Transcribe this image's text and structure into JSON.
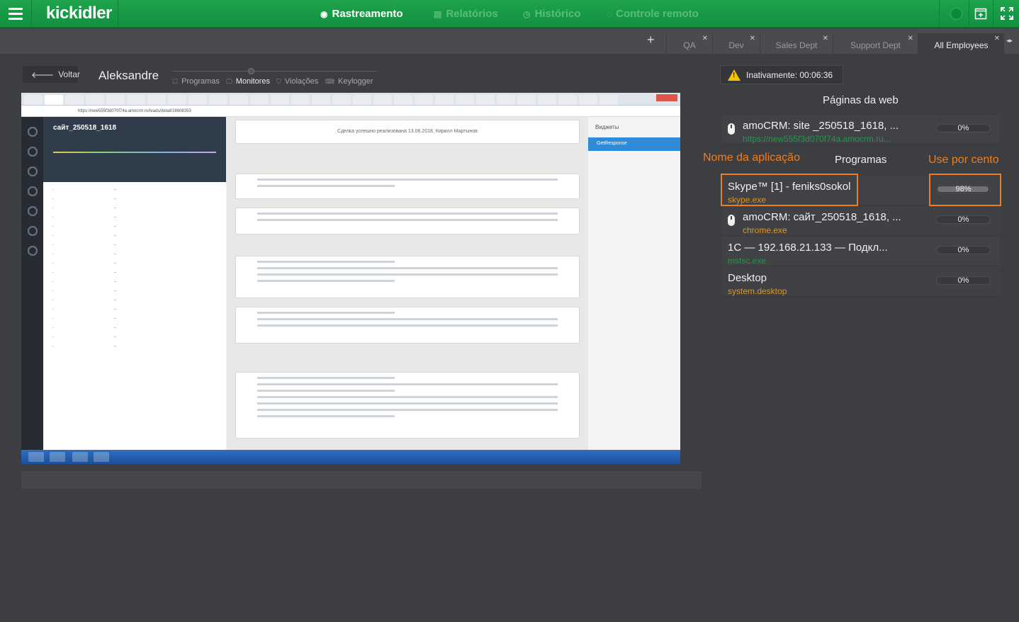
{
  "app": {
    "logo": "kickidler"
  },
  "nav": [
    {
      "label": "Rastreamento",
      "icon": "eye-icon",
      "glyph": "◉"
    },
    {
      "label": "Relatórios",
      "icon": "report-icon",
      "glyph": "▤"
    },
    {
      "label": "Histórico",
      "icon": "history-icon",
      "glyph": "◷"
    },
    {
      "label": "Controle remoto",
      "icon": "remote-icon",
      "glyph": "◌"
    }
  ],
  "tabs": [
    {
      "label": "QA"
    },
    {
      "label": "Dev"
    },
    {
      "label": "Sales Dept"
    },
    {
      "label": "Support Dept"
    },
    {
      "label": "All Employees"
    }
  ],
  "toolbar": {
    "back_label": "Voltar",
    "user_name": "Aleksandre",
    "submenu": [
      "Programas",
      "Monitores",
      "Violações",
      "Keylogger"
    ]
  },
  "screenshot": {
    "lead_title": "сайт_250518_1618",
    "url": "https://new555f3d070f74a.amocrm.ru/leads/detail/16608353",
    "status_banner": "Сделка успешно реализована 13.06.2018, Кирилл Мартынов",
    "widgets_title": "Виджеты",
    "widget_button": "GetResponse"
  },
  "panel": {
    "inactive_label": "Inativamente: 00:06:36",
    "web_title": "Páginas da web",
    "web_pages": [
      {
        "name": "amoCRM: site _250518_1618, ...",
        "url": "https://new555f3d070f74a.amocrm.ru...",
        "percent": "0%",
        "level": 0
      }
    ],
    "app_title": "Programas",
    "label_app_name": "Nome da aplicação",
    "label_usage": "Use por cento",
    "programs": [
      {
        "name": "Skype™ [1] - feniks0sokol",
        "exe": "skype.exe",
        "percent": "98%",
        "level": 0.98
      },
      {
        "name": "amoCRM: сайт_250518_1618, ...",
        "exe": "chrome.exe",
        "percent": "0%",
        "level": 0
      },
      {
        "name": "1C — 192.168.21.133 — Подкл...",
        "exe": "mstsc.exe",
        "percent": "0%",
        "level": 0
      },
      {
        "name": "Desktop",
        "exe": "system.desktop",
        "percent": "0%",
        "level": 0
      }
    ]
  },
  "colors": {
    "brand": "#1ea34c",
    "highlight": "#f07d1c",
    "exe_green": "#1b9c48",
    "exe_orange": "#e0961c"
  }
}
